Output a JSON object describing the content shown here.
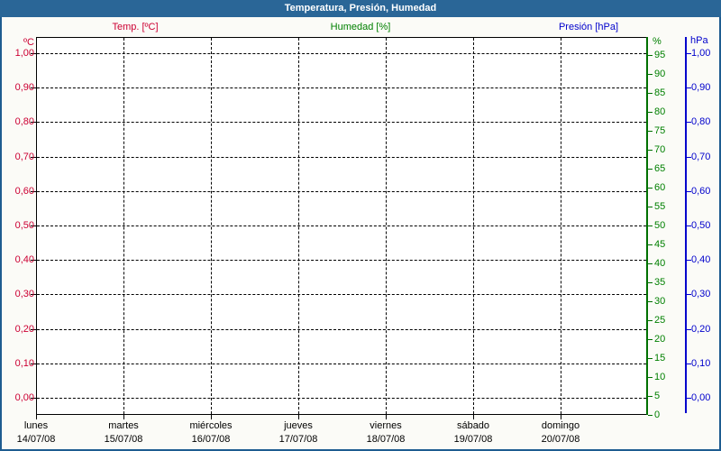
{
  "window": {
    "title": "Temperatura, Presión, Humedad"
  },
  "legend": {
    "items": [
      {
        "label": "Temp. [ºC]",
        "color": "#cc0033"
      },
      {
        "label": "Humedad [%]",
        "color": "#008000"
      },
      {
        "label": "Presión [hPa]",
        "color": "#0000cc"
      }
    ]
  },
  "colors": {
    "titlebar": "#2a6697",
    "window_border": "#1e5c90",
    "temperature": "#cc0033",
    "humidity": "#008000",
    "pressure": "#0000cc",
    "gridline": "#000000"
  },
  "chart_data": {
    "type": "line",
    "title": "Temperatura, Presión, Humedad",
    "grid": true,
    "x_axis": {
      "days": [
        {
          "name": "lunes",
          "date": "14/07/08"
        },
        {
          "name": "martes",
          "date": "15/07/08"
        },
        {
          "name": "miércoles",
          "date": "16/07/08"
        },
        {
          "name": "jueves",
          "date": "17/07/08"
        },
        {
          "name": "viernes",
          "date": "18/07/08"
        },
        {
          "name": "sábado",
          "date": "19/07/08"
        },
        {
          "name": "domingo",
          "date": "20/07/08"
        }
      ]
    },
    "y_axes": {
      "temperature": {
        "unit": "ºC",
        "side": "left",
        "color": "#cc0033",
        "min": 0.0,
        "max": 1.0,
        "step": 0.1,
        "tick_labels": [
          "1,00",
          "0,90",
          "0,80",
          "0,70",
          "0,60",
          "0,50",
          "0,40",
          "0,30",
          "0,20",
          "0,10",
          "0,00"
        ]
      },
      "humidity": {
        "unit": "%",
        "side": "right",
        "color": "#008000",
        "min": 0,
        "max": 95,
        "step": 5,
        "tick_labels": [
          "95",
          "90",
          "85",
          "80",
          "75",
          "70",
          "65",
          "60",
          "55",
          "50",
          "45",
          "40",
          "35",
          "30",
          "25",
          "20",
          "15",
          "10",
          "5",
          "0"
        ]
      },
      "pressure": {
        "unit": "hPa",
        "side": "right",
        "color": "#0000cc",
        "min": 0.0,
        "max": 1.0,
        "step": 0.1,
        "tick_labels": [
          "1,00",
          "0,90",
          "0,80",
          "0,70",
          "0,60",
          "0,50",
          "0,40",
          "0,30",
          "0,20",
          "0,10",
          "0,00"
        ]
      }
    },
    "series": [
      {
        "name": "Temp. [ºC]",
        "values": []
      },
      {
        "name": "Humedad [%]",
        "values": []
      },
      {
        "name": "Presión [hPa]",
        "values": []
      }
    ]
  }
}
